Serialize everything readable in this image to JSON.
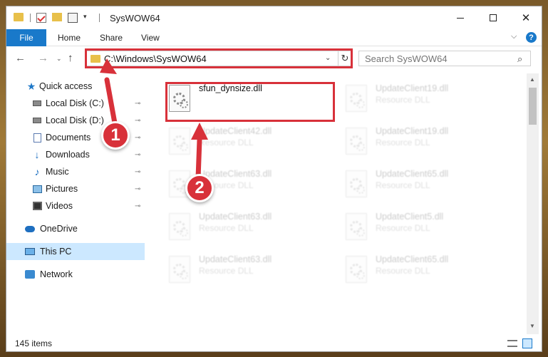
{
  "window": {
    "title": "SysWOW64"
  },
  "quick_access_toolbar": {
    "dropdown_symbol": "▾"
  },
  "window_controls": {
    "close_symbol": "✕"
  },
  "ribbon": {
    "tabs": [
      "File",
      "Home",
      "Share",
      "View"
    ],
    "expand_symbol": "⌵",
    "help_symbol": "?"
  },
  "navigation": {
    "back_symbol": "←",
    "forward_symbol": "→",
    "recent_symbol": "⌄",
    "up_symbol": "↑",
    "address": "C:\\Windows\\SysWOW64",
    "address_dropdown_symbol": "⌄",
    "refresh_symbol": "↻",
    "search_placeholder": "Search SysWOW64",
    "search_symbol": "⌕"
  },
  "sidebar": {
    "items": [
      {
        "label": "Quick access",
        "icon": "star-icon",
        "pinned": false
      },
      {
        "label": "Local Disk (C:)",
        "icon": "disk-icon",
        "pinned": true
      },
      {
        "label": "Local Disk (D:)",
        "icon": "disk-icon",
        "pinned": true
      },
      {
        "label": "Documents",
        "icon": "document-icon",
        "pinned": true
      },
      {
        "label": "Downloads",
        "icon": "download-icon",
        "pinned": true
      },
      {
        "label": "Music",
        "icon": "music-icon",
        "pinned": true
      },
      {
        "label": "Pictures",
        "icon": "picture-icon",
        "pinned": true
      },
      {
        "label": "Videos",
        "icon": "video-icon",
        "pinned": true
      },
      {
        "label": "OneDrive",
        "icon": "cloud-icon",
        "pinned": false
      },
      {
        "label": "This PC",
        "icon": "computer-icon",
        "pinned": false,
        "selected": true
      },
      {
        "label": "Network",
        "icon": "network-icon",
        "pinned": false
      }
    ],
    "pin_symbol": "📌"
  },
  "files": [
    {
      "name": "sfun_dynsize.dll",
      "type": "",
      "highlighted": true
    },
    {
      "name": "UpdateClient19.dll",
      "type": "Resource DLL"
    },
    {
      "name": "UpdateClient42.dll",
      "type": "Resource DLL"
    },
    {
      "name": "UpdateClient19.dll",
      "type": "Resource DLL"
    },
    {
      "name": "UpdateClient63.dll",
      "type": "Resource DLL"
    },
    {
      "name": "UpdateClient65.dll",
      "type": "Resource DLL"
    },
    {
      "name": "UpdateClient63.dll",
      "type": "Resource DLL"
    },
    {
      "name": "UpdateClient5.dll",
      "type": "Resource DLL"
    },
    {
      "name": "UpdateClient63.dll",
      "type": "Resource DLL"
    },
    {
      "name": "UpdateClient65.dll",
      "type": "Resource DLL"
    }
  ],
  "scrollbar": {
    "up_symbol": "▲",
    "down_symbol": "▼"
  },
  "status": {
    "item_count": "145 items"
  },
  "annotations": {
    "step1": "1",
    "step2": "2",
    "color": "#d8313a"
  }
}
